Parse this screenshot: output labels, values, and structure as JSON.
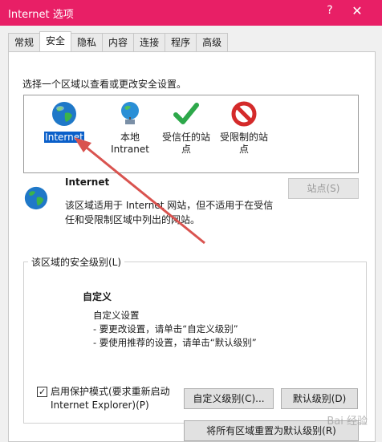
{
  "window": {
    "title": "Internet 选项",
    "help": "?",
    "close": "✕"
  },
  "tabs": [
    "常规",
    "安全",
    "隐私",
    "内容",
    "连接",
    "程序",
    "高级"
  ],
  "active_tab": "安全",
  "zone_prompt": "选择一个区域以查看或更改安全设置。",
  "zones": [
    {
      "label": "Internet",
      "icon": "globe-icon",
      "selected": true
    },
    {
      "label": "本地\nIntranet",
      "icon": "local-intranet-icon"
    },
    {
      "label": "受信任的站\n点",
      "icon": "trusted-sites-check-icon"
    },
    {
      "label": "受限制的站\n点",
      "icon": "restricted-sites-icon"
    }
  ],
  "selected_zone": {
    "name": "Internet",
    "description": "该区域适用于 Internet 网站，但不适用于在受信任和受限制区域中列出的网站。",
    "sites_button": "站点(S)"
  },
  "security_level": {
    "group_title": "该区域的安全级别(L)",
    "level_name": "自定义",
    "lines": [
      "自定义设置",
      "- 要更改设置，请单击“自定义级别”",
      "- 要使用推荐的设置，请单击“默认级别”"
    ]
  },
  "protected_mode": {
    "label": "启用保护模式(要求重新启动 Internet Explorer)(P)",
    "checked": true
  },
  "buttons": {
    "custom_level": "自定义级别(C)...",
    "default_level": "默认级别(D)",
    "reset_all": "将所有区域重置为默认级别(R)"
  },
  "watermark": "Bai 经验",
  "colors": {
    "titlebar": "#e81f66",
    "selection": "#0a5fc9",
    "annotation_arrow": "#d9534f"
  }
}
